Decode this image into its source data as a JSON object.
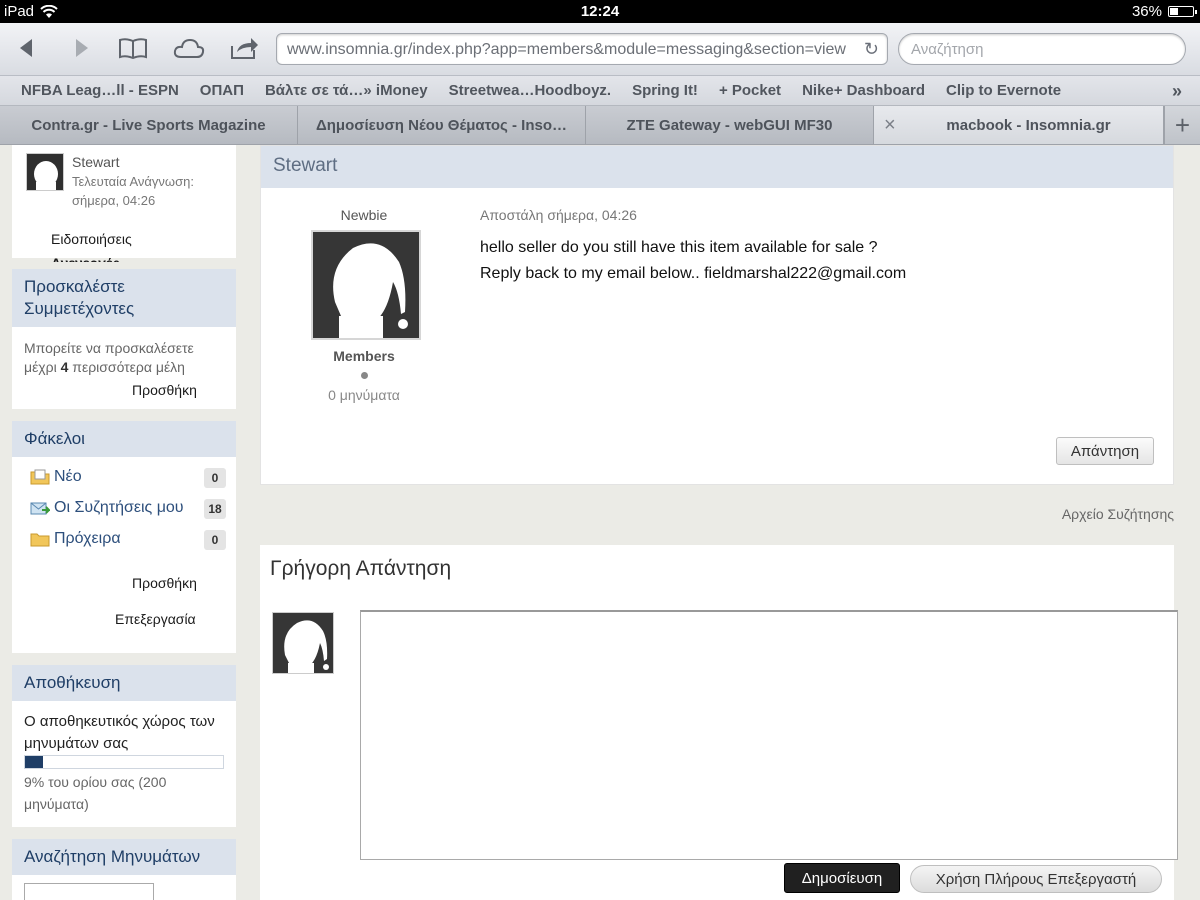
{
  "status_bar": {
    "device": "iPad",
    "time": "12:24",
    "battery": "36%",
    "battery_level": 0.36
  },
  "toolbar": {
    "url": "www.insomnia.gr/index.php?app=members&module=messaging&section=view",
    "search_placeholder": "Αναζήτηση"
  },
  "bookmarks": [
    "NFBA Leag…ll - ESPN",
    "ΟΠΑΠ",
    "Βάλτε σε τά…» iMoney",
    "Streetwea…Hoodboyz.",
    "Spring It!",
    "+ Pocket",
    "Nike+ Dashboard",
    "Clip to Evernote"
  ],
  "tabs": [
    "Contra.gr - Live Sports Magazine",
    "Δημοσίευση Νέου Θέματος - Inso…",
    "ZTE Gateway - webGUI MF30",
    "macbook - Insomnia.gr"
  ],
  "sidebar": {
    "user": {
      "name": "Stewart",
      "last_read": "Τελευταία Ανάγνωση:",
      "last_read_time": "σήμερα, 04:26"
    },
    "notifications_link": "Ειδοποιήσεις",
    "unread_cut": "Ανενεργές",
    "invite": {
      "title": "Προσκαλέστε Συμμετέχοντες",
      "text_a": "Μπορείτε να προσκαλέσετε",
      "text_b": "μέχρι ",
      "count": "4",
      "text_c": " περισσότερα μέλη",
      "add": "Προσθήκη"
    },
    "folders": {
      "title": "Φάκελοι",
      "items": [
        {
          "label": "Νέο",
          "count": "0"
        },
        {
          "label": "Οι Συζητήσεις μου",
          "count": "18"
        },
        {
          "label": "Πρόχειρα",
          "count": "0"
        }
      ],
      "add": "Προσθήκη",
      "edit": "Επεξεργασία"
    },
    "storage": {
      "title": "Αποθήκευση",
      "text": "Ο αποθηκευτικός χώρος των μηνυμάτων σας",
      "usage_percent": 9,
      "note": "9% του ορίου σας (200 μηνύματα)"
    },
    "search": {
      "title": "Αναζήτηση Μηνυμάτων"
    }
  },
  "message": {
    "author": "Stewart",
    "rank": "Newbie",
    "group": "Members",
    "posts": "0 μηνύματα",
    "sent": "Αποστάλη σήμερα, 04:26",
    "line1": "hello seller do you still have this item available for sale ?",
    "line2": "Reply back to my email below.. fieldmarshal222@gmail.com",
    "reply_button": "Απάντηση"
  },
  "archive_link": "Αρχείο Συζήτησης",
  "quick_reply": {
    "title": "Γρήγορη Απάντηση",
    "post_button": "Δημοσίευση",
    "full_editor_button": "Χρήση Πλήρους Επεξεργαστή"
  }
}
